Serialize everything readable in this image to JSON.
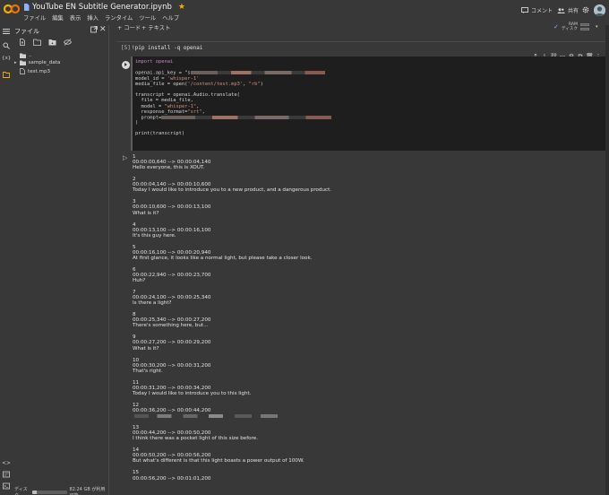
{
  "app": {
    "notebook_title": "YouTube EN Subtitle Generator.ipynb",
    "menu": [
      "ファイル",
      "編集",
      "表示",
      "挿入",
      "ランタイム",
      "ツール",
      "ヘルプ"
    ],
    "comment_label": "コメント",
    "share_label": "共有"
  },
  "toolbar": {
    "add_code": "+ コード",
    "add_text": "+ テキスト",
    "ram_label": "RAM",
    "disk_label": "ディスク"
  },
  "file_panel": {
    "title": "ファイル",
    "tree": [
      {
        "name": ".."
      },
      {
        "name": "sample_data"
      },
      {
        "name": "test.mp3"
      }
    ],
    "disk_text": "ディスク",
    "disk_usage_text": "82.24 GB が利用可能",
    "disk_fraction": 0.12
  },
  "cell1": {
    "exec_count": "[5]",
    "code": "!pip install -q openai"
  },
  "cell2": {
    "lines": {
      "l1": "import openai",
      "l3a": "openai.api_key = \"s",
      "l4a": "model_id = ",
      "l4b": "'whisper-1'",
      "l5a": "media_file = open(",
      "l5b": "'/content/test.mp3'",
      "l5c": ", ",
      "l5d": "\"rb\"",
      "l5e": ")",
      "l7": "transcript = openai.Audio.translate(",
      "l8": "  file = media_file,",
      "l9a": "  model = ",
      "l9b": "\"whisper-1\"",
      "l9c": ",",
      "l10a": "  response_format=",
      "l10b": "\"srt\"",
      "l10c": ",",
      "l11": "  prompt=",
      "l12": ")",
      "l14": "print(transcript)"
    }
  },
  "output": [
    {
      "n": "1",
      "t": "00:00:00,640 --> 00:00:04,140",
      "text": "Hello everyone, this is XOUT."
    },
    {
      "n": "2",
      "t": "00:00:04,140 --> 00:00:10,600",
      "text": "Today I would like to introduce you to a new product, and a dangerous product."
    },
    {
      "n": "3",
      "t": "00:00:10,600 --> 00:00:13,100",
      "text": "What is it?"
    },
    {
      "n": "4",
      "t": "00:00:13,100 --> 00:00:16,100",
      "text": "It's this guy here."
    },
    {
      "n": "5",
      "t": "00:00:16,100 --> 00:00:20,940",
      "text": "At first glance, it looks like a normal light, but please take a closer look."
    },
    {
      "n": "6",
      "t": "00:00:22,940 --> 00:00:23,700",
      "text": "Huh?"
    },
    {
      "n": "7",
      "t": "00:00:24,100 --> 00:00:25,340",
      "text": "Is there a light?"
    },
    {
      "n": "8",
      "t": "00:00:25,340 --> 00:00:27,200",
      "text": "There's something here, but..."
    },
    {
      "n": "9",
      "t": "00:00:27,200 --> 00:00:29,200",
      "text": "What is it?"
    },
    {
      "n": "10",
      "t": "00:00:30,200 --> 00:00:31,200",
      "text": "That's right."
    },
    {
      "n": "11",
      "t": "00:00:31,200 --> 00:00:34,200",
      "text": "Today I would like to introduce you to this light."
    },
    {
      "n": "12",
      "t": "00:00:36,200 --> 00:00:44,200",
      "text": ""
    },
    {
      "n": "13",
      "t": "00:00:44,200 --> 00:00:50,200",
      "text": "I think there was a pocket light of this size before."
    },
    {
      "n": "14",
      "t": "00:00:50,200 --> 00:00:56,200",
      "text": "But what's different is that this light boasts a power output of 100W."
    },
    {
      "n": "15",
      "t": "00:00:56,200 --> 00:01:01,200",
      "text": ""
    }
  ]
}
